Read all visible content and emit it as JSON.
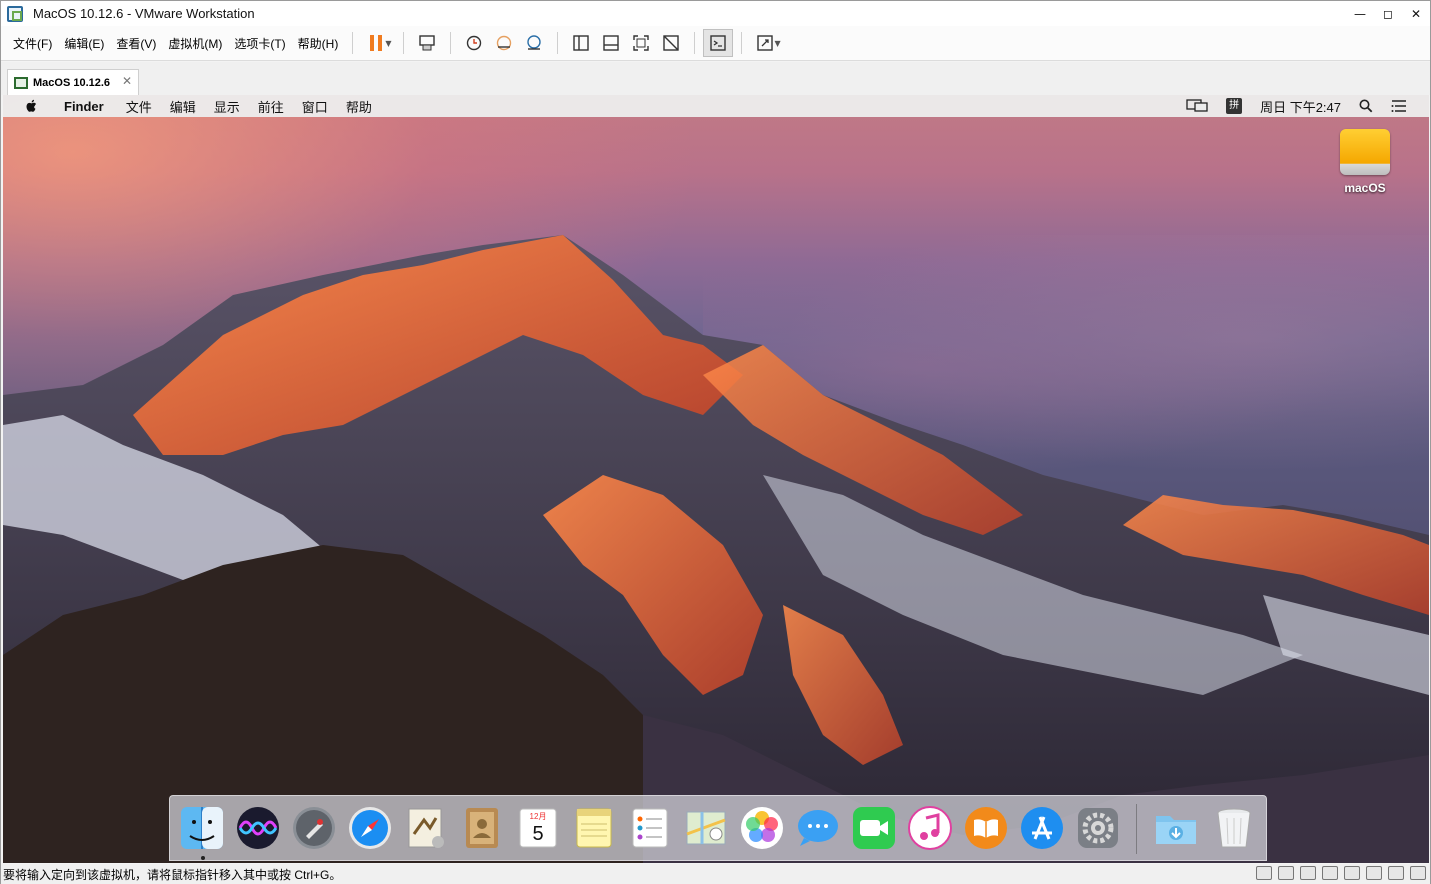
{
  "window": {
    "title": "MacOS 10.12.6 - VMware Workstation",
    "controls": {
      "minimize": "—",
      "maximize": "◻",
      "close": "✕"
    }
  },
  "vm_menu": [
    "文件(F)",
    "编辑(E)",
    "查看(V)",
    "虚拟机(M)",
    "选项卡(T)",
    "帮助(H)"
  ],
  "toolbar_icons": [
    "pause-icon",
    "send-ctrl-alt-del-icon",
    "snapshot-icon",
    "revert-snapshot-icon",
    "snapshot-manager-icon",
    "library-icon",
    "thumbnail-icon",
    "fullscreen-icon",
    "unity-icon",
    "console-icon",
    "stretch-icon"
  ],
  "tab": {
    "label": "MacOS 10.12.6",
    "close": "✕"
  },
  "mac_menubar": {
    "app": "Finder",
    "items": [
      "文件",
      "编辑",
      "显示",
      "前往",
      "窗口",
      "帮助"
    ],
    "ime": "拼",
    "clock": "周日 下午2:47"
  },
  "desktop": {
    "disk_label": "macOS"
  },
  "dock": {
    "apps": [
      "finder-icon",
      "siri-icon",
      "launchpad-icon",
      "safari-icon",
      "mail-icon",
      "contacts-icon",
      "calendar-icon",
      "notes-icon",
      "reminders-icon",
      "maps-icon",
      "photos-icon",
      "messages-icon",
      "facetime-icon",
      "itunes-icon",
      "ibooks-icon",
      "app-store-icon",
      "system-preferences-icon"
    ],
    "calendar": {
      "month": "12月",
      "day": "5"
    },
    "trailing": [
      "downloads-folder-icon",
      "trash-icon"
    ]
  },
  "statusbar": {
    "text": "要将输入定向到该虚拟机，请将鼠标指针移入其中或按 Ctrl+G。"
  },
  "colors": {
    "accent_pause": "#f07b1f",
    "desktop_sky": "#8e6a95"
  }
}
